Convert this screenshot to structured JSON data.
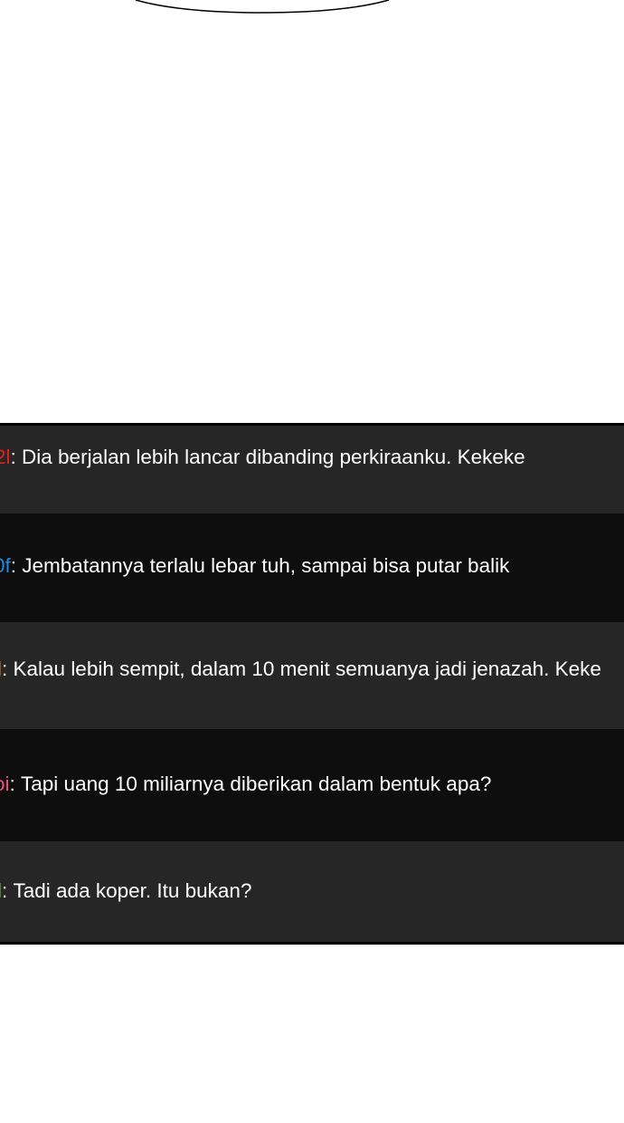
{
  "colors": {
    "red": "#e0201e",
    "blue": "#1f8be0",
    "orange": "#f07f18",
    "pink": "#f04f7f",
    "green": "#7fd82a"
  },
  "messages": [
    {
      "user": "2l",
      "sep": ": ",
      "text": "Dia berjalan lebih lancar dibanding perkiraanku. Kekeke",
      "color": "#e0201e"
    },
    {
      "user": "0f",
      "sep": ": ",
      "text": "Jembatannya terlalu lebar tuh, sampai bisa putar balik",
      "color": "#1f8be0"
    },
    {
      "user": "l",
      "sep": ": ",
      "text": "Kalau lebih sempit, dalam 10 menit semuanya jadi jenazah. Keke",
      "color": "#f07f18"
    },
    {
      "user": "oi",
      "sep": ": ",
      "text": "Tapi uang 10 miliarnya diberikan dalam bentuk apa?",
      "color": "#f04f7f"
    },
    {
      "user": "l",
      "sep": ": ",
      "text": "Tadi ada koper. Itu bukan?",
      "color": "#7fd82a"
    }
  ]
}
